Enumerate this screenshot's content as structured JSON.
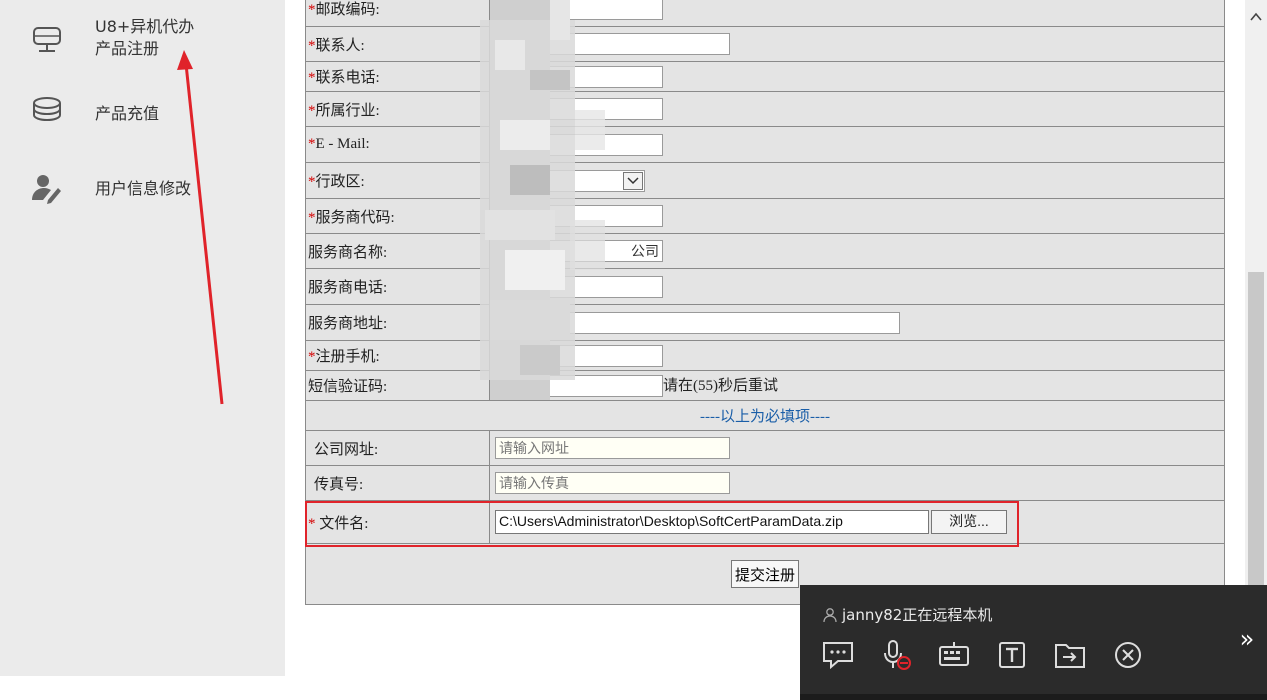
{
  "sidebar": {
    "items": [
      {
        "label_line1": "U8+异机代办",
        "label_line2": "产品注册",
        "icon": "monitor-icon"
      },
      {
        "label": "产品充值",
        "icon": "coins-icon"
      },
      {
        "label": "用户信息修改",
        "icon": "user-edit-icon"
      }
    ]
  },
  "form": {
    "postal_code": {
      "label": "邮政编码:"
    },
    "contact": {
      "label": "联系人:"
    },
    "contact_phone": {
      "label": "联系电话:"
    },
    "industry": {
      "label": "所属行业:"
    },
    "email": {
      "label": "E - Mail:"
    },
    "region": {
      "label": "行政区:"
    },
    "provider_code": {
      "label": "服务商代码:"
    },
    "provider_name": {
      "label": "服务商名称:",
      "value_suffix": "公司"
    },
    "provider_phone": {
      "label": "服务商电话:"
    },
    "provider_address": {
      "label": "服务商地址:"
    },
    "reg_mobile": {
      "label": "注册手机:"
    },
    "sms_code": {
      "label": "短信验证码:",
      "retry_text": "请在(55)秒后重试"
    },
    "required_note": "----以上为必填项----",
    "website": {
      "label": "公司网址:",
      "placeholder": "请输入网址"
    },
    "fax": {
      "label": "传真号:",
      "placeholder": "请输入传真"
    },
    "file": {
      "label": "文件名:",
      "value": "C:\\Users\\Administrator\\Desktop\\SoftCertParamData.zip",
      "browse_label": "浏览..."
    },
    "submit_label": "提交注册",
    "required_mark": "*"
  },
  "remote": {
    "title": "janny82正在远程本机",
    "icons": [
      "chat-icon",
      "mic-muted-icon",
      "keyboard-icon",
      "text-icon",
      "folder-transfer-icon",
      "close-icon"
    ],
    "expand_label": "»"
  },
  "colors": {
    "annotation": "#e0232a",
    "required": "#d40000",
    "note": "#1a5ea8"
  }
}
